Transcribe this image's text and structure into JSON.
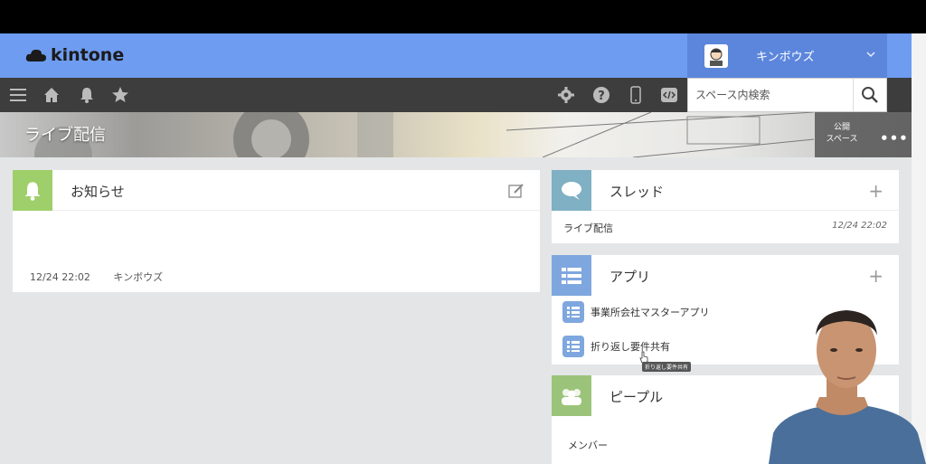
{
  "app": {
    "logo_text": "kintone"
  },
  "user": {
    "name": "キンボウズ"
  },
  "search": {
    "placeholder": "スペース内検索"
  },
  "toolbar": {
    "icons": [
      "menu-icon",
      "home-icon",
      "bell-icon",
      "star-icon",
      "gear-icon",
      "help-icon",
      "mobile-icon",
      "code-icon",
      "search-icon"
    ]
  },
  "banner": {
    "title": "ライブ配信",
    "public_label_line1": "公開",
    "public_label_line2": "スペース",
    "more": "•••"
  },
  "notice": {
    "title": "お知らせ",
    "date": "12/24 22:02",
    "author": "キンボウズ"
  },
  "thread": {
    "title": "スレッド",
    "plus": "+",
    "items": [
      {
        "name": "ライブ配信",
        "date": "12/24 22:02"
      }
    ]
  },
  "apps": {
    "title": "アプリ",
    "plus": "+",
    "items": [
      {
        "name": "事業所会社マスターアプリ"
      },
      {
        "name": "折り返し要件共有"
      }
    ],
    "tooltip": "折り返し要件共有"
  },
  "people": {
    "title": "ピープル",
    "members_label": "メンバー"
  },
  "colors": {
    "header": "#6e9cf0",
    "toolbar": "#3d3d3d",
    "notice_icon_bg": "#9fcf6a",
    "thread_icon_bg": "#7fb0c4",
    "apps_icon_bg": "#7fa7df",
    "people_icon_bg": "#9bc47a"
  }
}
